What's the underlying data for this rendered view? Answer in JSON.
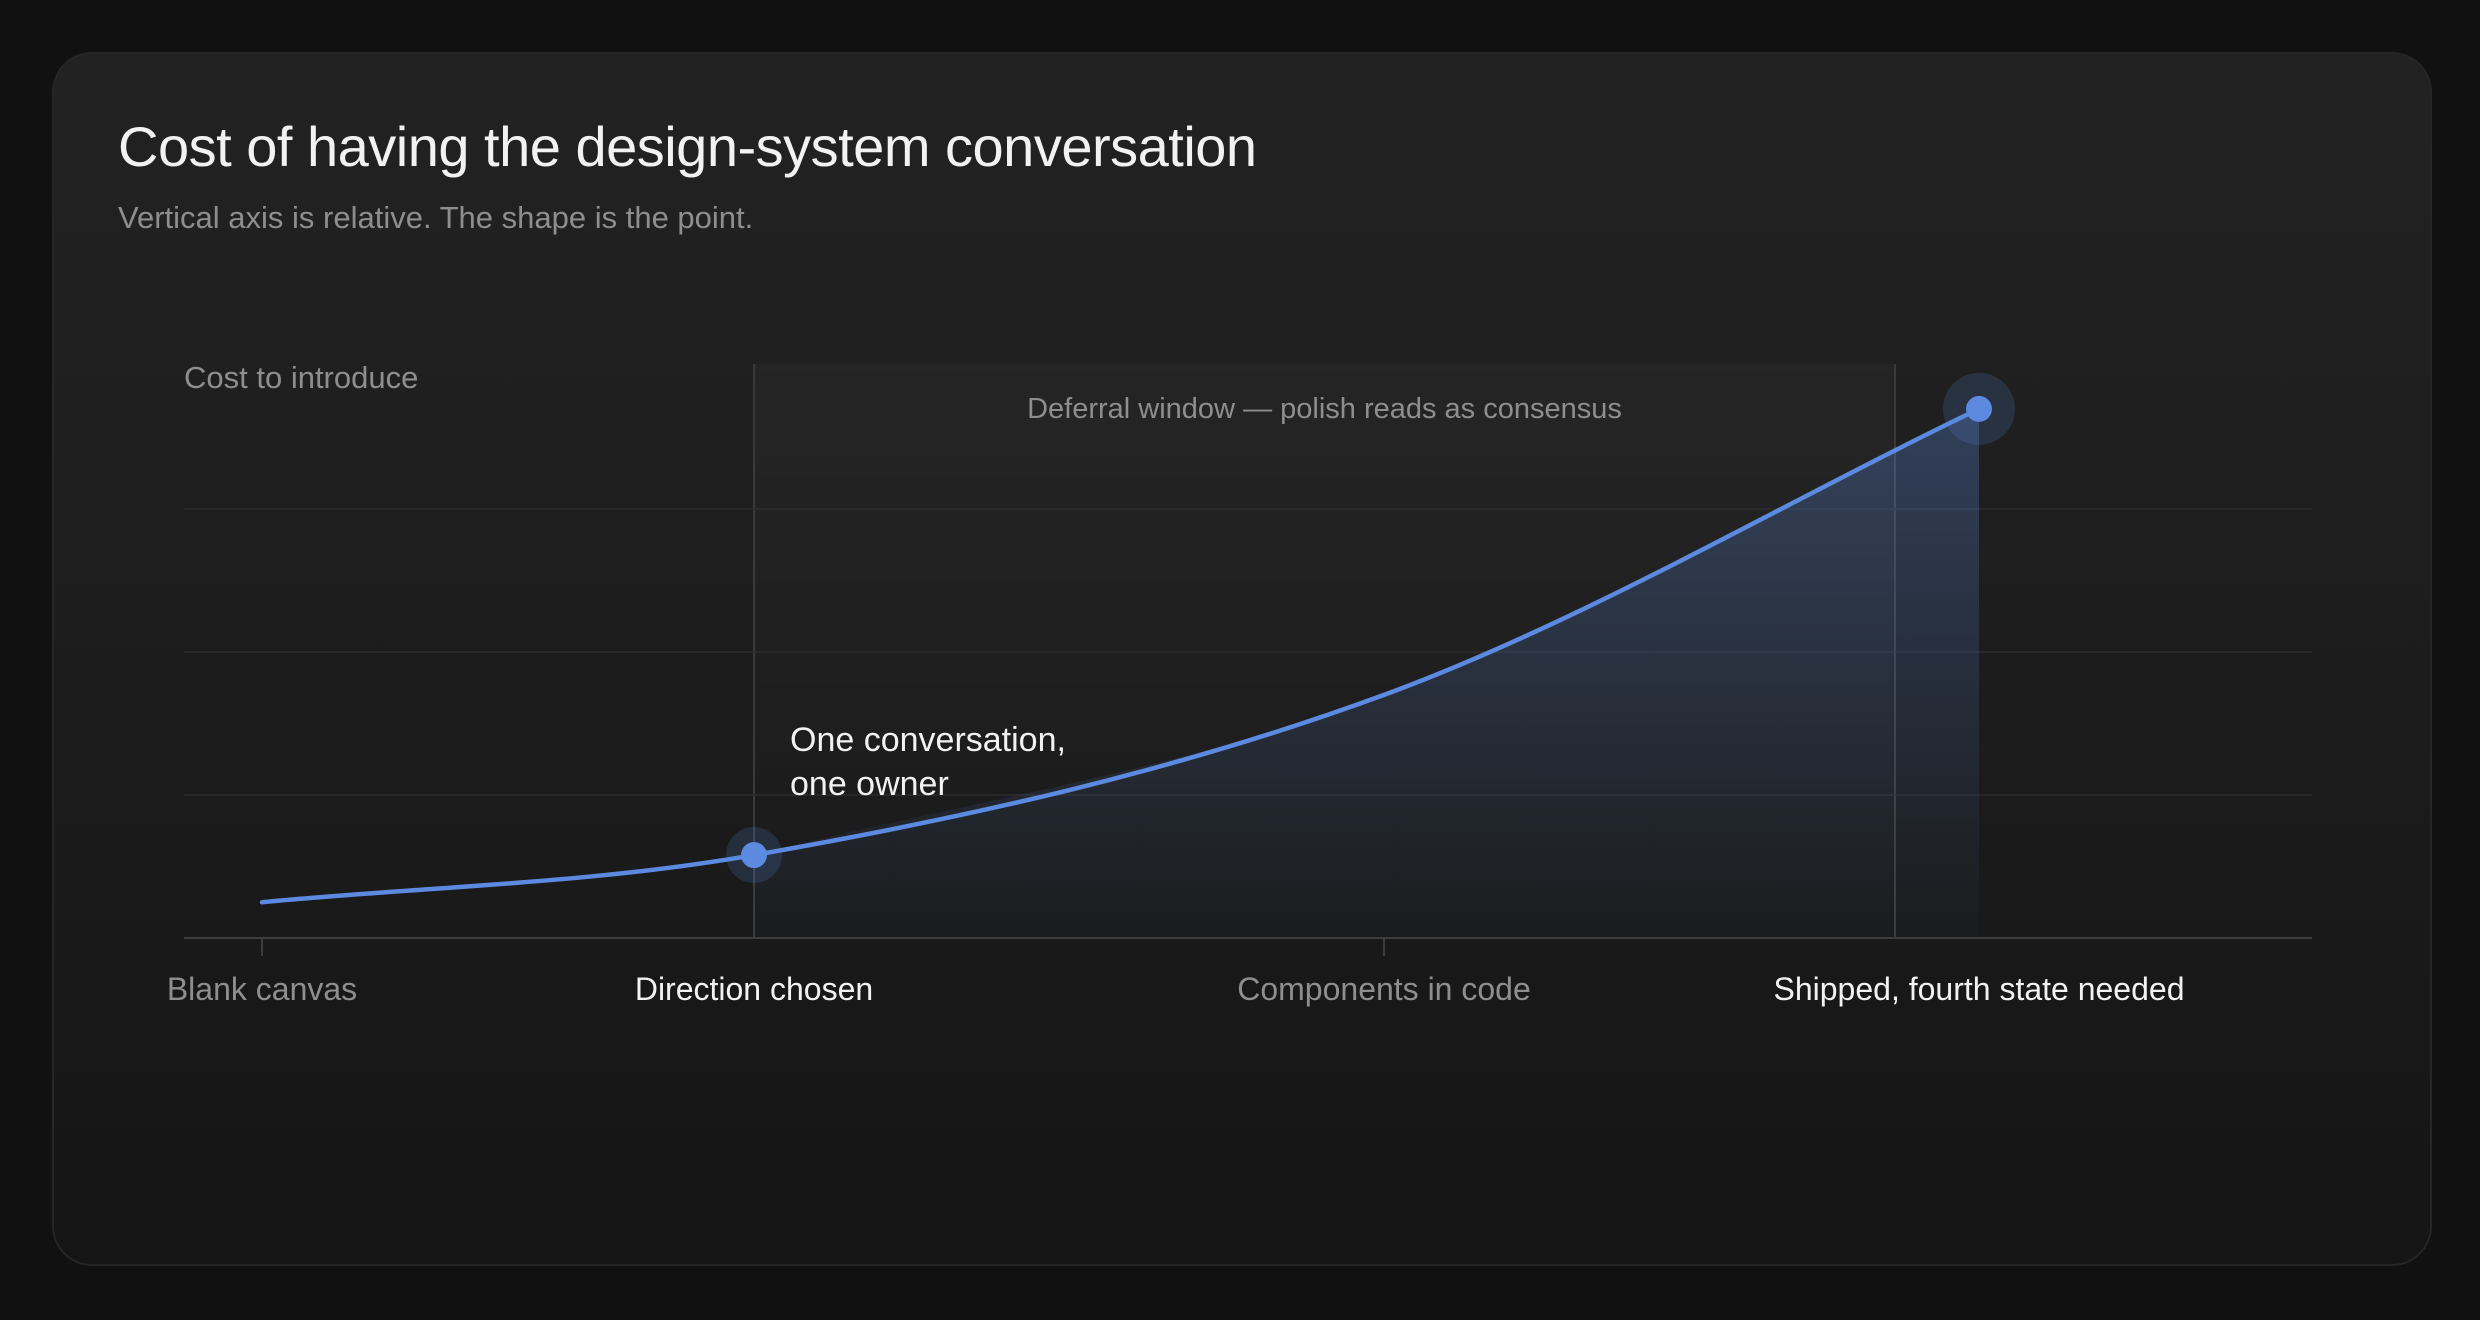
{
  "chart_data": {
    "type": "area",
    "title": "Cost of having the design-system conversation",
    "subtitle": "Vertical axis is relative. The shape is the point.",
    "ylabel": "Cost to introduce",
    "xlabel": "",
    "grid": true,
    "ylim": [
      0,
      4
    ],
    "categories": [
      "Blank canvas",
      "Direction chosen",
      "Components in code",
      "Shipped, fourth state needed"
    ],
    "series": [
      {
        "values": [
          0.25,
          0.58,
          1.7,
          3.7
        ],
        "color": "#5b8ae0"
      }
    ],
    "highlighted_categories": [
      "Direction chosen",
      "Shipped, fourth state needed"
    ],
    "shaded_region": {
      "from": "Direction chosen",
      "to": "Shipped, fourth state needed",
      "label": "Deferral window — polish reads as consensus"
    },
    "annotations": [
      {
        "at": "Direction chosen",
        "lines": [
          "One conversation,",
          "one owner"
        ]
      }
    ]
  }
}
